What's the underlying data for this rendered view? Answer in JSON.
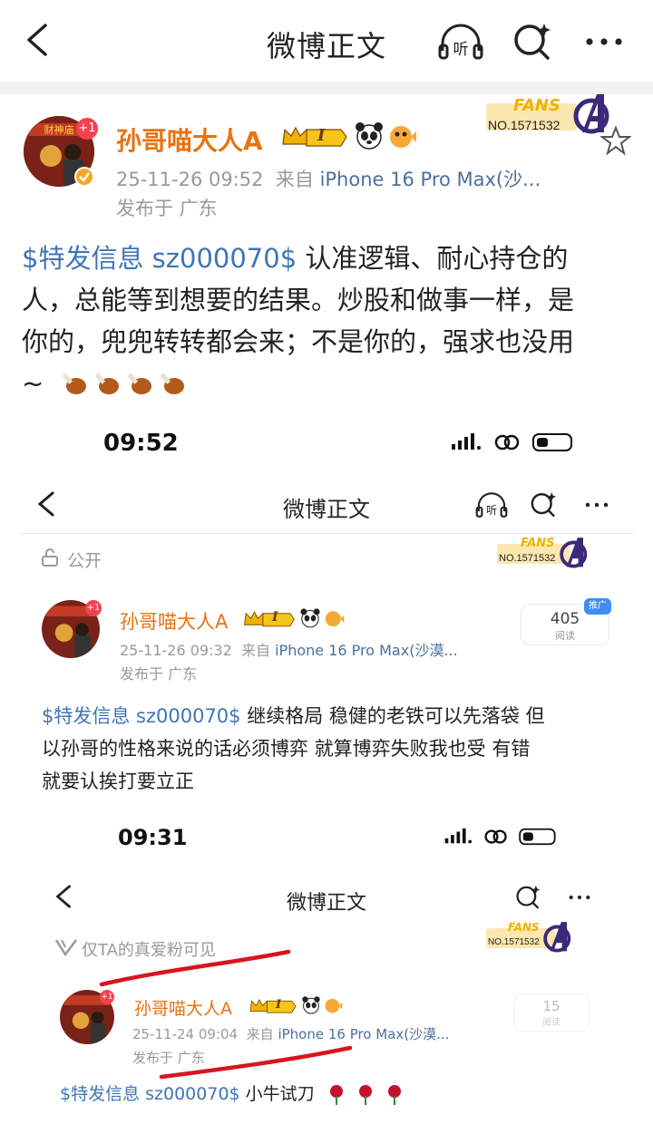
{
  "nav": {
    "title": "微博正文"
  },
  "post": {
    "username": "孙哥喵大人A",
    "level": "I",
    "avatar_badge": "+1",
    "timestamp": "25-11-26 09:52",
    "source_prefix": "来自",
    "source": "iPhone 16 Pro Max(沙...",
    "location": "发布于 广东",
    "fans_label": "FANS",
    "fans_no": "NO.1571532",
    "tag": "$特发信息 sz000070$",
    "text_line1": "  认准逻辑、耐心持仓的",
    "text_line2": "人，总能等到想要的结果。炒股和做事一样，是",
    "text_line3": "你的，兜兜转转都会来；不是你的，强求也没用",
    "text_line4": "~ "
  },
  "shot1": {
    "time": "09:52",
    "nav_title": "微博正文",
    "visibility": "公开",
    "fans_label": "FANS",
    "fans_no": "NO.1571532",
    "username": "孙哥喵大人A",
    "level": "I",
    "avatar_badge": "+1",
    "timestamp": "25-11-26 09:32",
    "source_prefix": "来自",
    "source": "iPhone 16 Pro Max(沙漠...",
    "location": "发布于 广东",
    "reads": "405",
    "reads_label": "阅读",
    "reads_tag": "推广",
    "tag": "$特发信息 sz000070$",
    "text_line1": " 继续格局 稳健的老铁可以先落袋 但",
    "text_line2": "以孙哥的性格来说的话必须博弈 就算博弈失败我也受 有错",
    "text_line3": "就要认挨打要立正"
  },
  "shot2": {
    "time": "09:31",
    "nav_title": "微博正文",
    "visibility": "仅TA的真爱粉可见",
    "fans_label": "FANS",
    "fans_no": "NO.1571532",
    "username": "孙哥喵大人A",
    "level": "I",
    "avatar_badge": "+1",
    "timestamp": "25-11-24 09:04",
    "source_prefix": "来自",
    "source": "iPhone 16 Pro Max(沙漠...",
    "location": "发布于 广东",
    "reads": "15",
    "reads_label": "阅读",
    "tag": "$特发信息 sz000070$",
    "text": " 小牛试刀"
  },
  "colors": {
    "accent": "#e8730f",
    "link": "#3f75b8",
    "gold": "#f0b100",
    "red_mark": "#d8141f"
  }
}
